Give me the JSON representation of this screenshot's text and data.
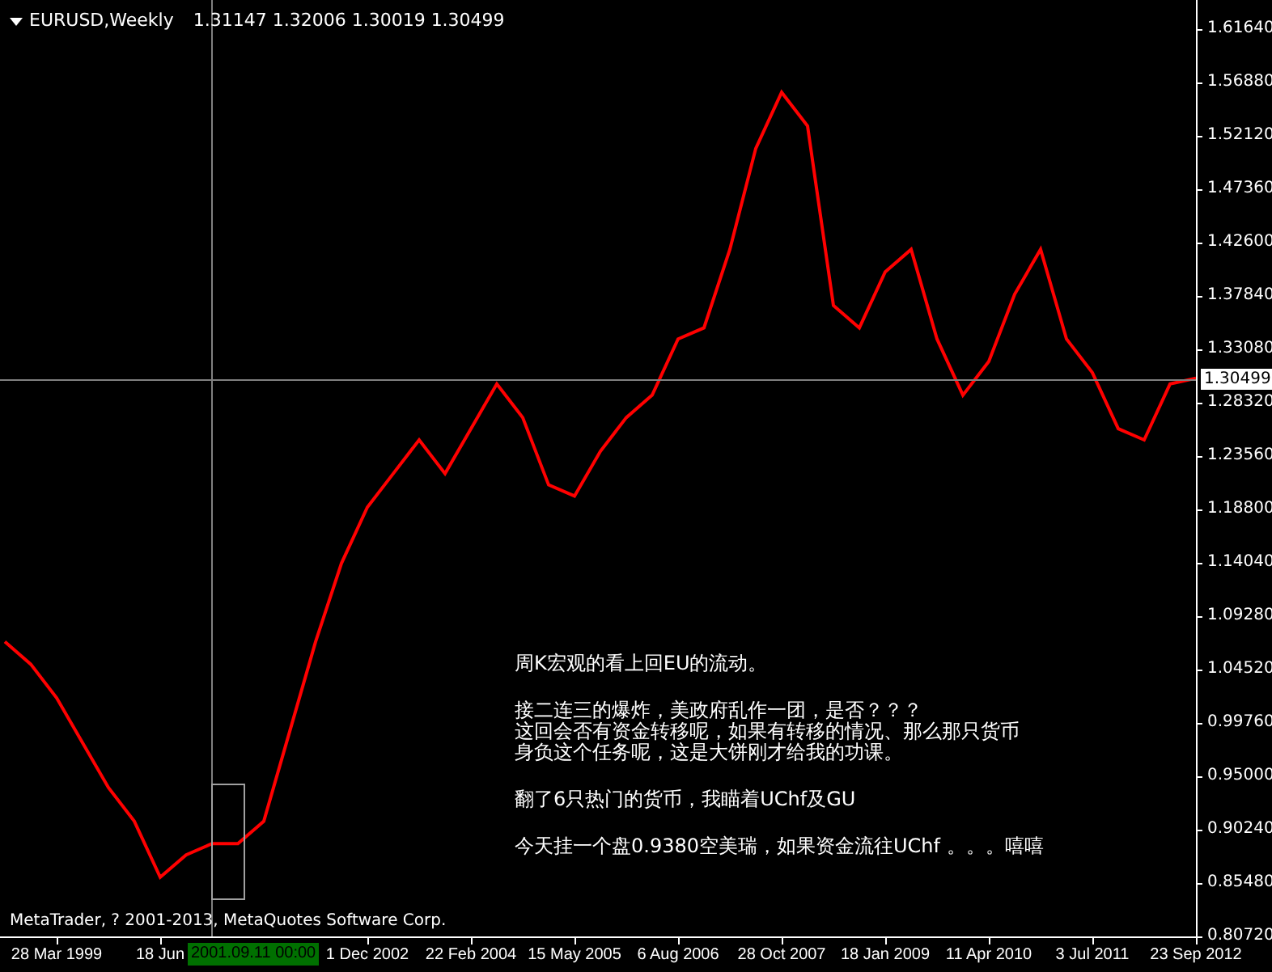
{
  "header": {
    "symbol": "EURUSD,Weekly",
    "open": "1.31147",
    "high": "1.32006",
    "low": "1.30019",
    "close": "1.30499"
  },
  "chart": {
    "chart_data": {
      "type": "line",
      "ylim": [
        0.8058,
        1.6424
      ],
      "categories": [
        null,
        null,
        "28 Mar 1999",
        null,
        null,
        null,
        "18 Jun",
        null,
        null,
        null,
        null,
        null,
        null,
        null,
        "1 Dec 2002",
        null,
        null,
        null,
        "22 Feb 2004",
        null,
        null,
        null,
        "15 May 2005",
        null,
        null,
        null,
        "6 Aug 2006",
        null,
        null,
        null,
        "28 Oct 2007",
        null,
        null,
        null,
        "18 Jan 2009",
        null,
        null,
        null,
        "11 Apr 2010",
        null,
        null,
        null,
        "3 Jul 2011",
        null,
        null,
        null,
        "23 Sep 2012"
      ],
      "series": [
        {
          "color": "#ff0000",
          "values": [
            1.07,
            1.05,
            1.02,
            0.98,
            0.94,
            0.91,
            0.86,
            0.88,
            0.89,
            0.89,
            0.91,
            0.99,
            1.07,
            1.14,
            1.19,
            1.22,
            1.25,
            1.22,
            1.26,
            1.3,
            1.27,
            1.21,
            1.2,
            1.24,
            1.27,
            1.29,
            1.34,
            1.35,
            1.42,
            1.51,
            1.56,
            1.53,
            1.37,
            1.35,
            1.4,
            1.42,
            1.34,
            1.29,
            1.32,
            1.38,
            1.42,
            1.34,
            1.31,
            1.26,
            1.25,
            1.3,
            1.305
          ]
        }
      ],
      "yticks": [
        {
          "value": 1.6164,
          "label": "1.61640"
        },
        {
          "value": 1.5688,
          "label": "1.56880"
        },
        {
          "value": 1.5212,
          "label": "1.52120"
        },
        {
          "value": 1.4736,
          "label": "1.47360"
        },
        {
          "value": 1.426,
          "label": "1.42600"
        },
        {
          "value": 1.3784,
          "label": "1.37840"
        },
        {
          "value": 1.3308,
          "label": "1.33080"
        },
        {
          "value": 1.2832,
          "label": "1.28320"
        },
        {
          "value": 1.2356,
          "label": "1.23560"
        },
        {
          "value": 1.188,
          "label": "1.18800"
        },
        {
          "value": 1.1404,
          "label": "1.14040"
        },
        {
          "value": 1.0928,
          "label": "1.09280"
        },
        {
          "value": 1.0452,
          "label": "1.04520"
        },
        {
          "value": 0.9976,
          "label": "0.99760"
        },
        {
          "value": 0.95,
          "label": "0.95000"
        },
        {
          "value": 0.9024,
          "label": "0.90240"
        },
        {
          "value": 0.8548,
          "label": "0.85480"
        },
        {
          "value": 0.8072,
          "label": "0.80720"
        }
      ]
    }
  },
  "crosshair": {
    "date": "2001.09.11 00:00",
    "price": "1.30499"
  },
  "note_paragraphs": [
    [
      "周K宏观的看上回EU的流动。"
    ],
    [
      "接二连三的爆炸，美政府乱作一团，是否？？？",
      "这回会否有资金转移呢，如果有转移的情况、那么那只货币",
      "身负这个任务呢，这是大饼刚才给我的功课。"
    ],
    [
      "翻了6只热门的货币，我瞄着UChf及GU"
    ],
    [
      "今天挂一个盘0.9380空美瑞，如果资金流往UChf 。。。嘻嘻"
    ]
  ],
  "copyright": "MetaTrader, ? 2001-2013, MetaQuotes Software Corp."
}
